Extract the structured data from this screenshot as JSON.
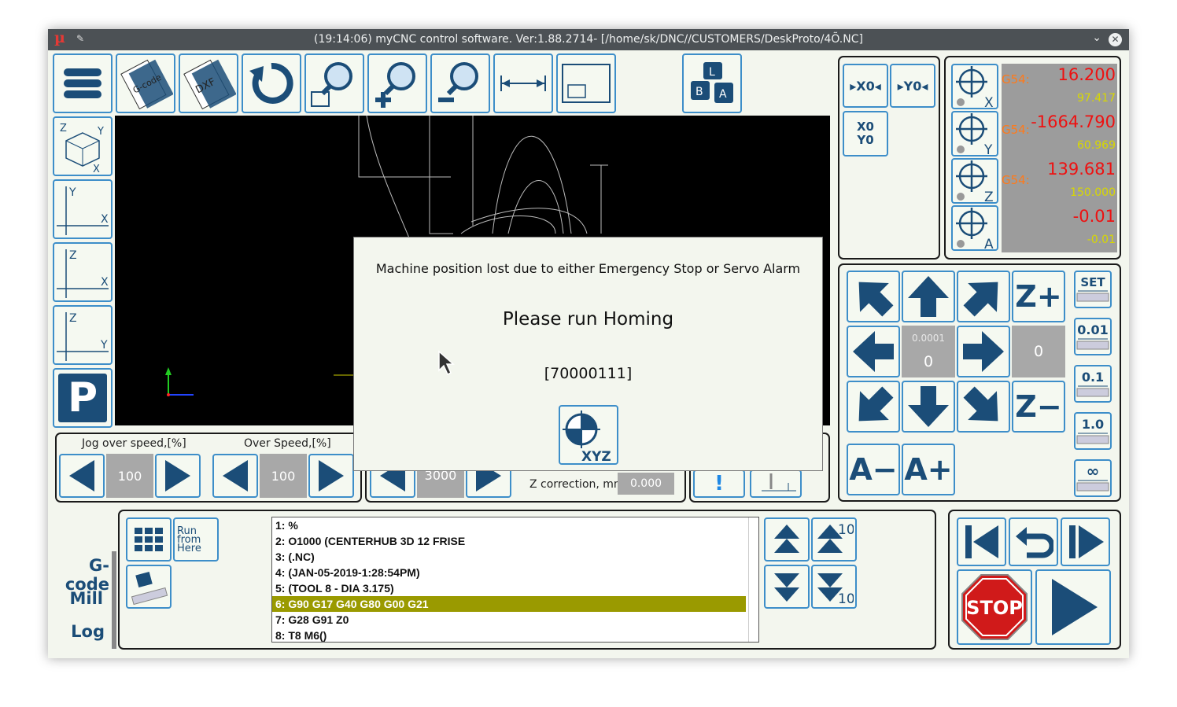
{
  "window": {
    "title": "(19:14:06) myCNC control software. Ver:1.88.2714- [/home/sk/DNC//CUSTOMERS/DeskProto/4Õ.NC]",
    "app_logo": "µ"
  },
  "toolbar": {
    "gcode_label": "G-code",
    "dxf_label": "DXF",
    "keys": [
      "L",
      "B",
      "A"
    ]
  },
  "view_buttons": [
    {
      "a": "Z",
      "b": "Y",
      "c": "X",
      "name": "view-3d"
    },
    {
      "a": "Y",
      "b": "X",
      "name": "view-xy"
    },
    {
      "a": "Z",
      "b": "X",
      "name": "view-xz"
    },
    {
      "a": "Z",
      "b": "Y",
      "name": "view-yz"
    }
  ],
  "park_label": "P",
  "zero_buttons": {
    "x0": "▸X0◂",
    "y0": "▸Y0◂",
    "xy0_top": "X0",
    "xy0_bottom": "Y0"
  },
  "dro": [
    {
      "axis": "X",
      "wcs": "G54:",
      "value": "16.200",
      "machine": "97.417"
    },
    {
      "axis": "Y",
      "wcs": "G54:",
      "value": "-1664.790",
      "machine": "60.969"
    },
    {
      "axis": "Z",
      "wcs": "G54:",
      "value": "139.681",
      "machine": "150.000"
    },
    {
      "axis": "A",
      "wcs": "",
      "value": "-0.01",
      "machine": "-0.01"
    }
  ],
  "jog": {
    "z_plus": "Z+",
    "z_minus": "Z−",
    "a_minus": "A−",
    "a_plus": "A+",
    "step_display": "0.0001",
    "center_value": "0",
    "right_value": "0",
    "steps": [
      "SET",
      "0.01",
      "0.1",
      "1.0",
      "∞"
    ]
  },
  "speed": {
    "jog_over_label": "Jog over speed,[%]",
    "jog_over_value": "100",
    "over_label": "Over Speed,[%]",
    "over_value": "100",
    "spindle_value": "3000",
    "z_corr_label": "Z correction, mm",
    "z_corr_value": "0.000",
    "exclaim": "!"
  },
  "dialog": {
    "message": "Machine position lost due to either Emergency Stop or Servo Alarm",
    "headline": "Please run Homing",
    "code": "[70000111]",
    "home_label": "XYZ"
  },
  "gcode_tools": {
    "run_from_here": [
      "Run",
      "from",
      "Here"
    ]
  },
  "gcode_lines": [
    "1: %",
    "2: O1000 (CENTERHUB 3D 12 FRISE",
    "3: (.NC)",
    "4: (JAN-05-2019-1:28:54PM)",
    "5: (TOOL 8 - DIA 3.175)",
    "6: G90 G17 G40 G80 G00 G21",
    "7: G28 G91 Z0",
    "8: T8 M6()"
  ],
  "highlighted_line": 5,
  "scroll_steps": {
    "ten_up": "10",
    "ten_down": "10"
  },
  "side_tabs": [
    "G-code",
    "Mill",
    "Log"
  ],
  "run_controls": {
    "stop_label": "STOP"
  },
  "colors": {
    "accent": "#1b4d78",
    "button_border": "#3d8ec9",
    "dro_value": "#ee1111",
    "dro_machine": "#d8d800",
    "wcs": "#ff7a1a",
    "highlight": "#9a9a00"
  }
}
